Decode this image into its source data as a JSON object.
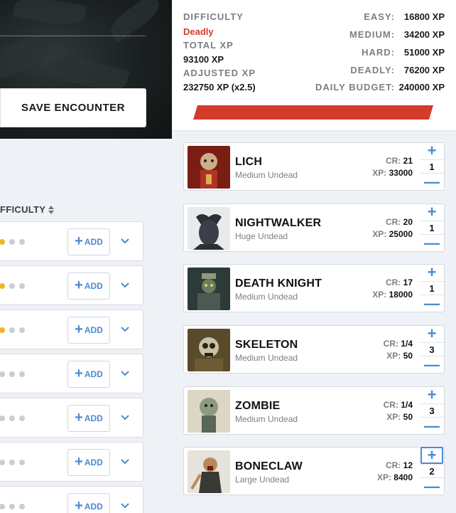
{
  "banner": {
    "save_label": "SAVE ENCOUNTER"
  },
  "list": {
    "column_header": "FFICULTY",
    "add_label": "ADD",
    "rows": [
      {
        "difficulty_dots": 1
      },
      {
        "difficulty_dots": 1
      },
      {
        "difficulty_dots": 1
      },
      {
        "difficulty_dots": 0
      },
      {
        "difficulty_dots": 0
      },
      {
        "difficulty_dots": 0
      },
      {
        "difficulty_dots": 0
      }
    ]
  },
  "summary": {
    "difficulty_label": "DIFFICULTY",
    "difficulty_value": "Deadly",
    "total_xp_label": "TOTAL XP",
    "total_xp_value": "93100 XP",
    "adjusted_xp_label": "ADJUSTED XP",
    "adjusted_xp_value": "232750 XP (x2.5)",
    "thresholds": [
      {
        "label": "EASY:",
        "value": "16800 XP"
      },
      {
        "label": "MEDIUM:",
        "value": "34200 XP"
      },
      {
        "label": "HARD:",
        "value": "51000 XP"
      },
      {
        "label": "DEADLY:",
        "value": "76200 XP"
      },
      {
        "label": "DAILY BUDGET:",
        "value": "240000 XP"
      }
    ],
    "colors": {
      "deadly": "#d33c2a",
      "accent": "#4a8ad4"
    }
  },
  "monsters": [
    {
      "name": "LICH",
      "type": "Medium Undead",
      "cr_label": "CR:",
      "cr": "21",
      "xp_label": "XP:",
      "xp": "33000",
      "qty": "1"
    },
    {
      "name": "NIGHTWALKER",
      "type": "Huge Undead",
      "cr_label": "CR:",
      "cr": "20",
      "xp_label": "XP:",
      "xp": "25000",
      "qty": "1"
    },
    {
      "name": "DEATH KNIGHT",
      "type": "Medium Undead",
      "cr_label": "CR:",
      "cr": "17",
      "xp_label": "XP:",
      "xp": "18000",
      "qty": "1"
    },
    {
      "name": "SKELETON",
      "type": "Medium Undead",
      "cr_label": "CR:",
      "cr": "1/4",
      "xp_label": "XP:",
      "xp": "50",
      "qty": "3"
    },
    {
      "name": "ZOMBIE",
      "type": "Medium Undead",
      "cr_label": "CR:",
      "cr": "1/4",
      "xp_label": "XP:",
      "xp": "50",
      "qty": "3"
    },
    {
      "name": "BONECLAW",
      "type": "Large Undead",
      "cr_label": "CR:",
      "cr": "12",
      "xp_label": "XP:",
      "xp": "8400",
      "qty": "2"
    }
  ]
}
